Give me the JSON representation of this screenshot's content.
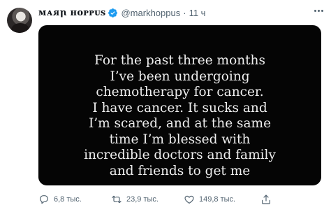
{
  "tweet": {
    "display_name": "ᴍᴀᴙꞃ ʜᴏᴘᴘᴜꜱ",
    "handle": "@markhoppus",
    "separator": "·",
    "time": "11 ч",
    "media_lines": [
      "For the past three months",
      "I’ve been undergoing",
      "chemotherapy for cancer.",
      "I have cancer. It sucks and",
      "I’m scared, and at the same",
      "time I’m blessed with",
      "incredible doctors and family",
      "and friends to get me"
    ]
  },
  "actions": {
    "reply_count": "6,8 тыс.",
    "retweet_count": "23,9 тыс.",
    "like_count": "149,8 тыс."
  },
  "colors": {
    "accent": "#1d9bf0",
    "secondary_text": "#536471",
    "media_background": "#050505"
  },
  "icons": [
    "verified-badge-icon",
    "more-icon",
    "reply-icon",
    "retweet-icon",
    "like-icon",
    "share-icon"
  ]
}
